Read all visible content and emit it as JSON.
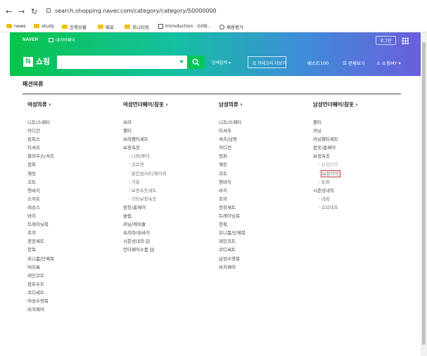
{
  "browser": {
    "url": "search.shopping.naver.com/category/category/50000000",
    "bookmarks": [
      {
        "label": "news",
        "icon": "folder-icon"
      },
      {
        "label": "study",
        "icon": "folder-icon"
      },
      {
        "label": "진행상황",
        "icon": "folder-icon"
      },
      {
        "label": "배포",
        "icon": "folder-icon"
      },
      {
        "label": "모니터링",
        "icon": "folder-icon"
      },
      {
        "label": "Introduction · GitB...",
        "icon": "book-icon"
      },
      {
        "label": "채용평가",
        "icon": "globe-icon"
      }
    ]
  },
  "header": {
    "brand": "NAVER",
    "pay": "네이버페이",
    "login": "로그인",
    "logo_letter": "N",
    "title": "쇼핑",
    "detail_search": "상세검색 ▾",
    "category_btn": "☰ 카테고리 더보기",
    "best100": "베스트100",
    "all_services": "☰ 전체보기",
    "my_shopping": "♙ 쇼핑MY ▾",
    "accent": "#03c75a"
  },
  "page": {
    "title": "패션의류"
  },
  "columns": [
    {
      "heading": "여성의류 ›",
      "items": [
        {
          "label": "니트/스웨터"
        },
        {
          "label": "카디건"
        },
        {
          "label": "원피스"
        },
        {
          "label": "티셔츠"
        },
        {
          "label": "블라우스/셔츠"
        },
        {
          "label": "점퍼"
        },
        {
          "label": "재킷"
        },
        {
          "label": "코트"
        },
        {
          "label": "청바지"
        },
        {
          "label": "스커트"
        },
        {
          "label": "레깅스"
        },
        {
          "label": "바지"
        },
        {
          "label": "트레이닝복"
        },
        {
          "label": "조끼"
        },
        {
          "label": "정장세트"
        },
        {
          "label": "한복"
        },
        {
          "label": "유니폼/단체복"
        },
        {
          "label": "머미룩"
        },
        {
          "label": "레인코트"
        },
        {
          "label": "점프슈트"
        },
        {
          "label": "코디세트"
        },
        {
          "label": "여성수영복"
        },
        {
          "label": "비치웨어"
        }
      ]
    },
    {
      "heading": "여성언더웨어/잠옷 ›",
      "items": [
        {
          "label": "브라"
        },
        {
          "label": "팬티"
        },
        {
          "label": "브라팬티세트"
        },
        {
          "label": "보정속옷"
        },
        {
          "label": "니퍼/루더",
          "sub": true
        },
        {
          "label": "코르셋",
          "sub": true
        },
        {
          "label": "올인원/바디쉐이퍼",
          "sub": true
        },
        {
          "label": "거들",
          "sub": true
        },
        {
          "label": "보정속옷세트",
          "sub": true
        },
        {
          "label": "기타보정속옷",
          "sub": true
        },
        {
          "label": "잠옷/홈웨어"
        },
        {
          "label": "슬립"
        },
        {
          "label": "러닝/캐미솔"
        },
        {
          "label": "속치마/속바지"
        },
        {
          "label": "시즌성내의",
          "plus": true
        },
        {
          "label": "언더웨어소품",
          "plus": true
        }
      ]
    },
    {
      "heading": "남성의류 ›",
      "items": [
        {
          "label": "니트/스웨터"
        },
        {
          "label": "티셔츠"
        },
        {
          "label": "셔츠/남방"
        },
        {
          "label": "카디건"
        },
        {
          "label": "점퍼"
        },
        {
          "label": "재킷"
        },
        {
          "label": "코트"
        },
        {
          "label": "청바지"
        },
        {
          "label": "바지"
        },
        {
          "label": "조끼"
        },
        {
          "label": "정장세트"
        },
        {
          "label": "트레이닝복"
        },
        {
          "label": "한복"
        },
        {
          "label": "유니폼/단체복"
        },
        {
          "label": "레인코트"
        },
        {
          "label": "코디세트"
        },
        {
          "label": "남성수영복"
        },
        {
          "label": "비치웨어"
        }
      ]
    },
    {
      "heading": "남성언더웨어/잠옷 ›",
      "items": [
        {
          "label": "팬티"
        },
        {
          "label": "러닝"
        },
        {
          "label": "러닝팬티세트"
        },
        {
          "label": "잠옷/홈웨어"
        },
        {
          "label": "보정속옷"
        },
        {
          "label": "보정상의",
          "sub": true,
          "dim": true
        },
        {
          "label": "보정하의",
          "sub": true,
          "highlight": true
        },
        {
          "label": "토퍼",
          "sub": true
        },
        {
          "label": "시즌성내의"
        },
        {
          "label": "내복",
          "sub": true
        },
        {
          "label": "로브데프",
          "sub": true
        }
      ]
    }
  ]
}
